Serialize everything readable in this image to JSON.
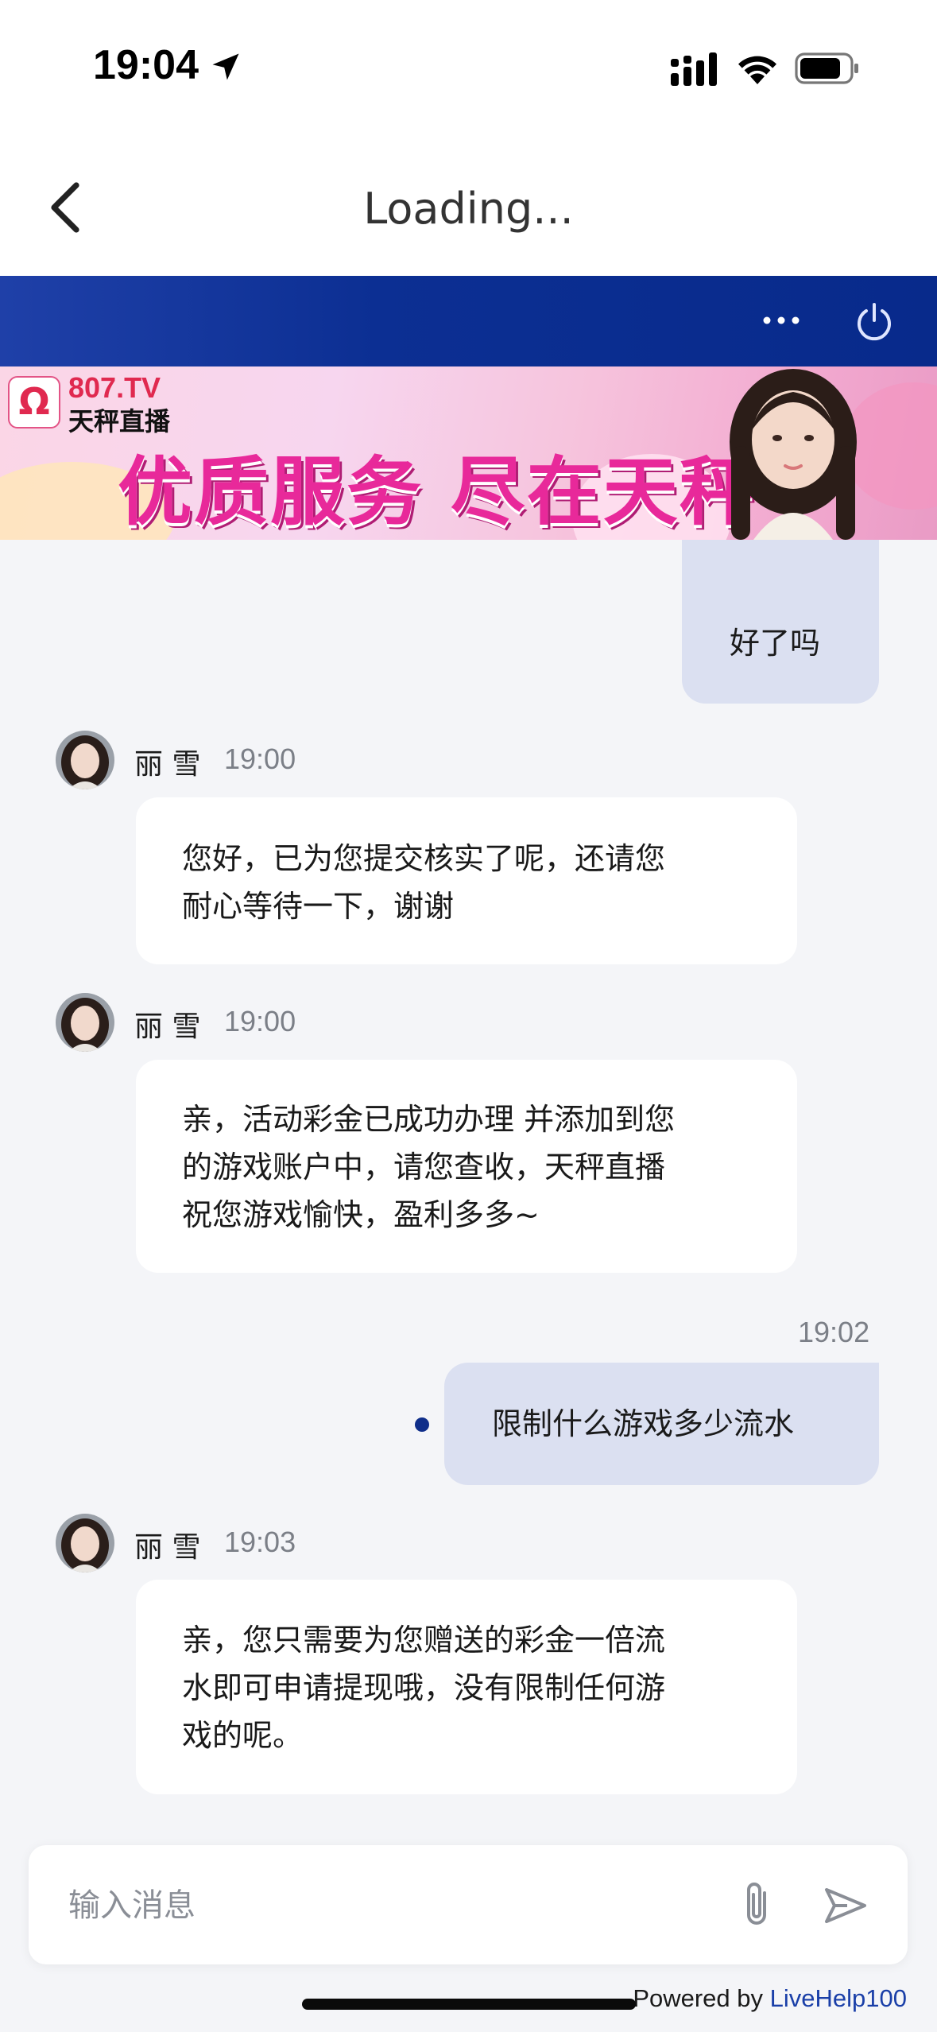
{
  "status_bar": {
    "time": "19:04"
  },
  "nav": {
    "title": "Loading..."
  },
  "banner": {
    "tv_text": "807.TV",
    "brand": "天秤直播",
    "slogan": "优质服务 尽在天秤"
  },
  "messages": [
    {
      "from": "user",
      "text": "好了吗"
    },
    {
      "from": "agent",
      "name": "丽 雪",
      "time": "19:00",
      "lines": [
        "您好，已为您提交核实了呢，还请您",
        "耐心等待一下，谢谢"
      ]
    },
    {
      "from": "agent",
      "name": "丽 雪",
      "time": "19:00",
      "lines": [
        "亲，活动彩金已成功办理 并添加到您",
        "的游戏账户中，请您查收，天秤直播",
        "祝您游戏愉快，盈利多多~"
      ]
    },
    {
      "from": "user",
      "time": "19:02",
      "text": "限制什么游戏多少流水"
    },
    {
      "from": "agent",
      "name": "丽 雪",
      "time": "19:03",
      "lines": [
        "亲，您只需要为您赠送的彩金一倍流",
        "水即可申请提现哦，没有限制任何游",
        "戏的呢。"
      ]
    }
  ],
  "input": {
    "placeholder": "输入消息"
  },
  "footer": {
    "powered_prefix": "Powered by ",
    "powered_link": "LiveHelp100"
  },
  "colors": {
    "header_blue": "#0c2f93",
    "user_bubble": "#dbe0f1",
    "accent_pink": "#e8299a"
  }
}
